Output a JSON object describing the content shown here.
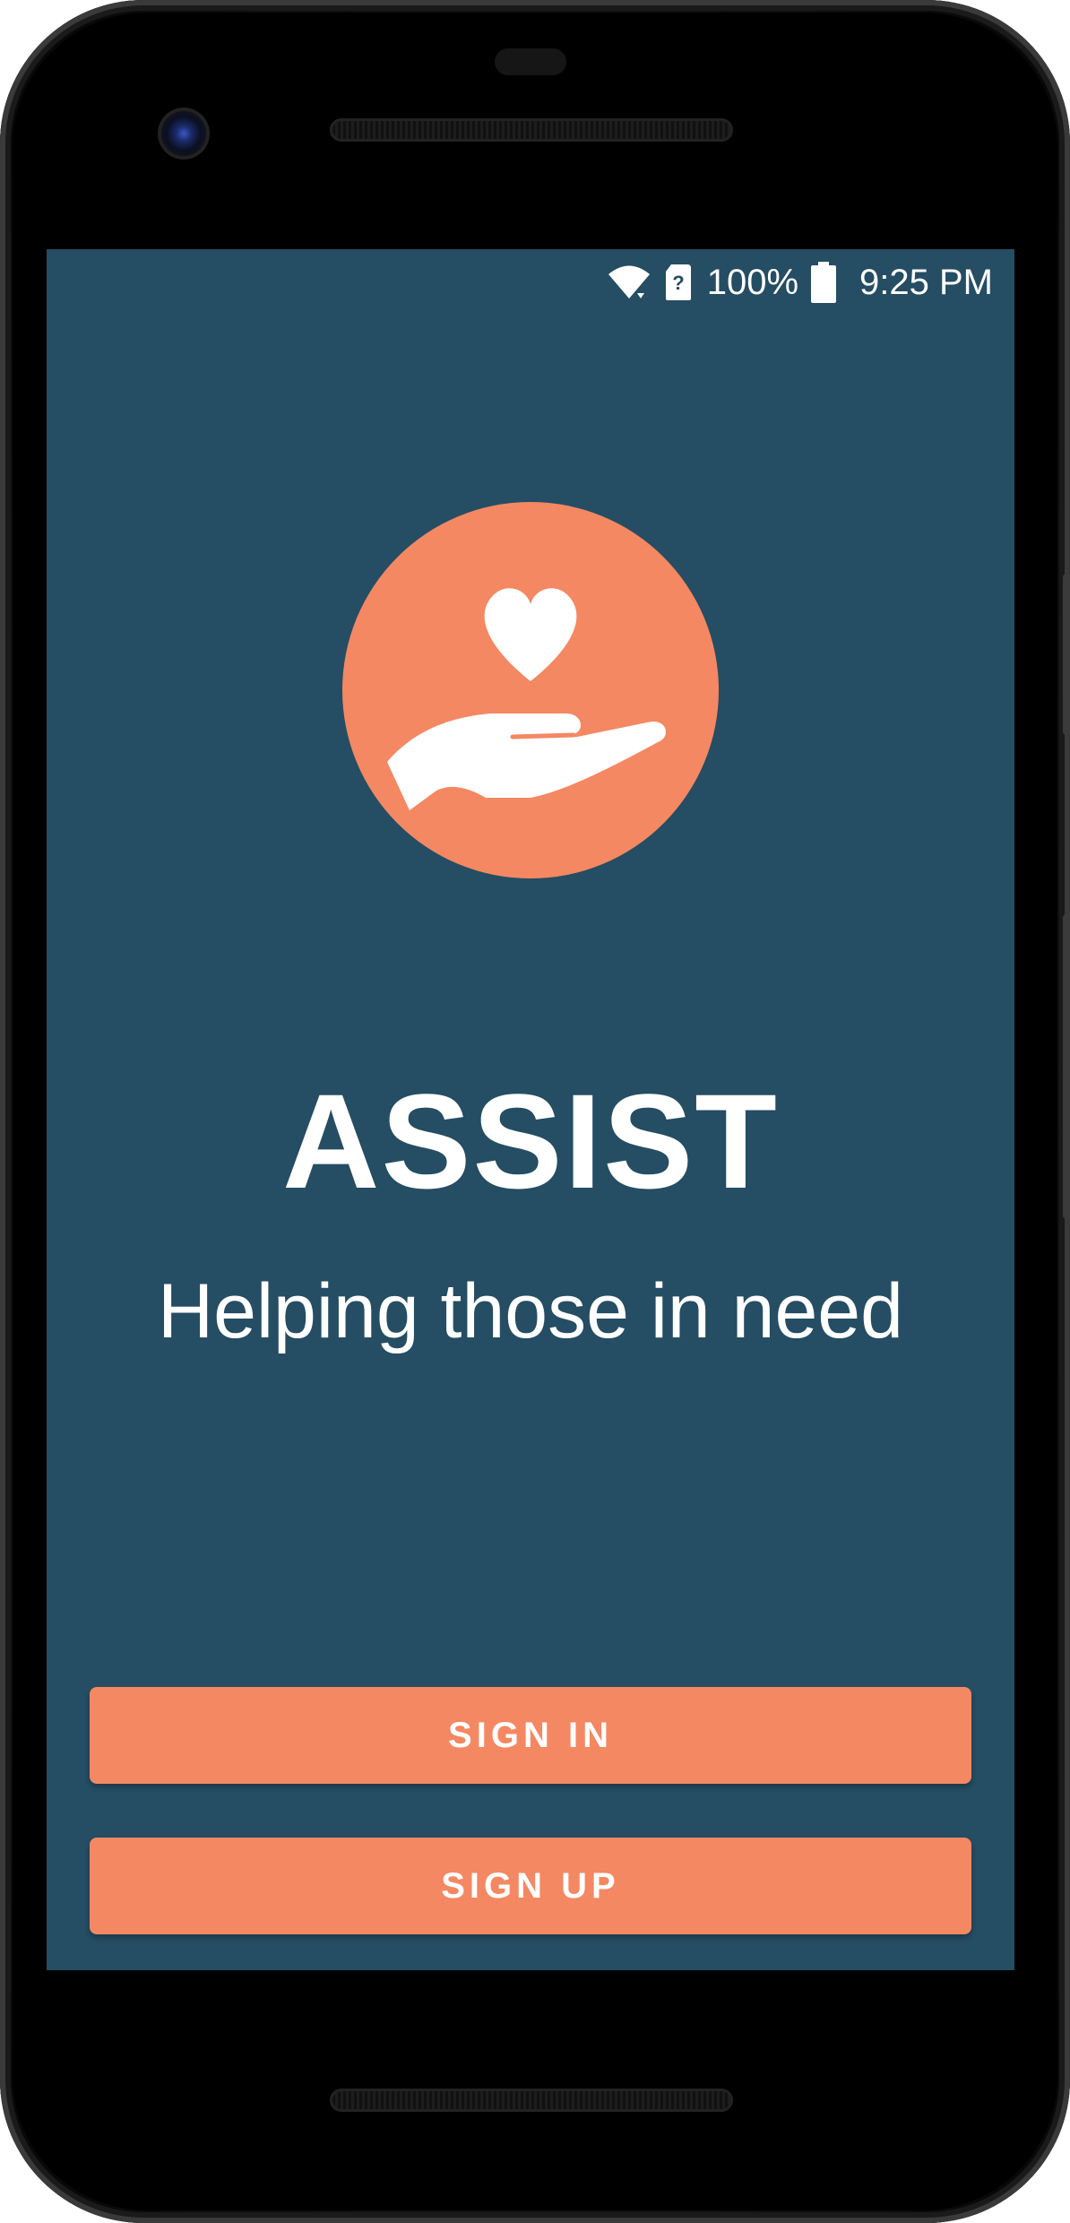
{
  "status_bar": {
    "battery_percent": "100%",
    "time": "9:25 PM",
    "icons": [
      "wifi-icon",
      "sim-unknown-icon",
      "battery-icon"
    ]
  },
  "app": {
    "title": "ASSIST",
    "tagline": "Helping those in need",
    "logo_icon": "heart-hand-icon"
  },
  "buttons": {
    "sign_in": "SIGN IN",
    "sign_up": "SIGN UP"
  },
  "colors": {
    "background": "#254d63",
    "accent": "#f48862",
    "text": "#ffffff"
  }
}
